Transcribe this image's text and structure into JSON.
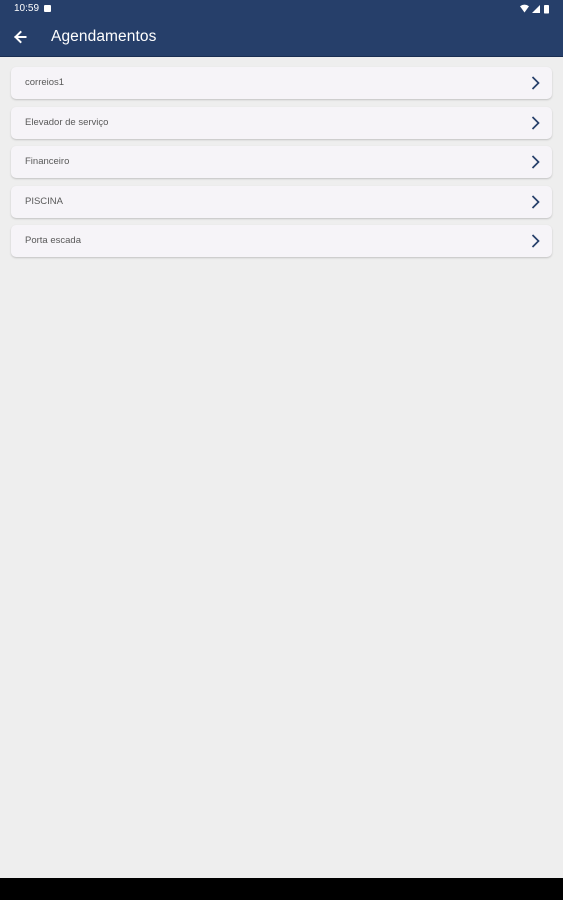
{
  "status_bar": {
    "time": "10:59",
    "icons": [
      "notification-icon",
      "wifi-icon",
      "cellular-signal-icon",
      "battery-icon"
    ]
  },
  "app_bar": {
    "title": "Agendamentos",
    "back_icon": "arrow-back-icon",
    "background_color": "#263f6a"
  },
  "list": {
    "items": [
      {
        "label": "correios1"
      },
      {
        "label": "Elevador de serviço"
      },
      {
        "label": "Financeiro"
      },
      {
        "label": "PISCINA"
      },
      {
        "label": "Porta escada"
      }
    ],
    "chevron_icon": "chevron-right-icon",
    "chevron_color": "#263f6a"
  },
  "colors": {
    "page_background": "#eeeeee",
    "card_background": "#f6f4f8"
  }
}
